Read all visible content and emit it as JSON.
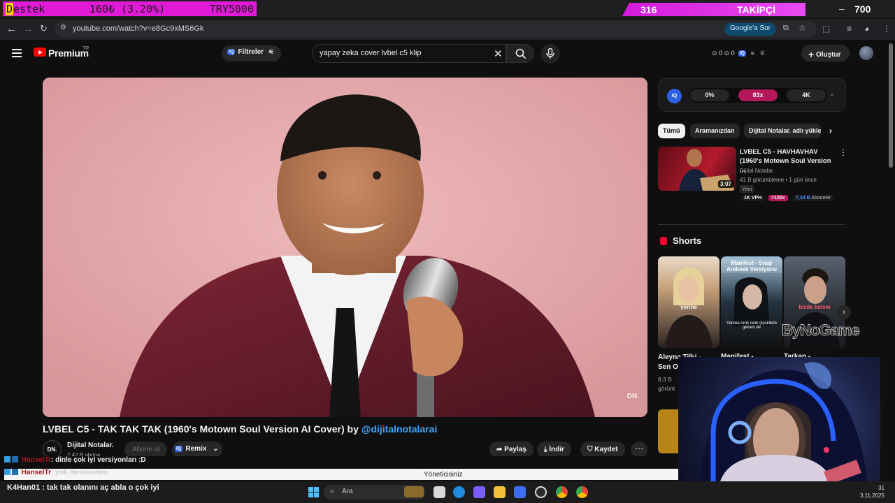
{
  "overlay": {
    "destek_first": "D",
    "destek_rest": "estek",
    "goal_amount": "160₺ (3.20%)",
    "goal_target": "TRY5000",
    "follower_count": "316",
    "follower_label": "TAKİPÇİ",
    "minimize": "–",
    "counter": "700"
  },
  "browser": {
    "url": "youtube.com/watch?v=e8Gc9xMS6Gk",
    "ask_google": "Google'a Sor"
  },
  "header": {
    "brand": "Premium",
    "country": "TR",
    "filters_label": "Filtreler",
    "search_value": "yapay zeka cover lvbel c5 klip",
    "header_stats": "⊙ 0  ⊙ 0",
    "create_label": "Oluştur"
  },
  "video": {
    "title": "LVBEL C5 - TAK TAK TAK (1960's Motown Soul Version AI Cover) by ",
    "title_link": "@dijitalnotalarai",
    "watermark": "DN.",
    "channel_avatar": "DN.",
    "channel_name": "Dijital Notalar.",
    "channel_subs": "7,42 B abone",
    "subscribe_label": "Abone ol",
    "remix_label": "Remix",
    "share_label": "Paylaş",
    "download_label": "İndir",
    "save_label": "Kaydet"
  },
  "iq_panel": {
    "badge": "IQ",
    "pill_1": "0%",
    "pill_2": "83x",
    "pill_3": "4K",
    "colors": {
      "highlight": "#b4185a"
    }
  },
  "chips": [
    "Tümü",
    "Aramanızdan",
    "Dijital Notalar. adlı yükleyiciden"
  ],
  "recommended": {
    "title": "LVBEL C5 - HAVHAVHAV (1960's Motown Soul Version ...",
    "channel": "Dijital Notalar.",
    "meta": "41 B görüntüleme • 1 gün önce",
    "badge_new": "Yeni",
    "duration": "3:07",
    "vph": "1K VPH",
    "outlier": ">100x",
    "subs_value": "7,34 B",
    "subs_label": "Aboneler"
  },
  "shorts": {
    "heading": "Shorts",
    "items": [
      {
        "title_line1": "Aleyna Tilki -",
        "title_line2": "Sen O",
        "meta_line1": "8,3 B",
        "meta_line2": "görünt",
        "caption": "yerine"
      },
      {
        "title_line1": "Manifest -",
        "caption_top": "Manifest - Snap Arabesk Versiyonu",
        "caption_bottom": "Yanına renk renk çiçeklerle gelsen de"
      },
      {
        "title_line1": "Tarkan -",
        "caption": "bizde kalsın"
      }
    ],
    "sponsor": "ByNoGame"
  },
  "chat": {
    "line1_user": "HanselTr",
    "line1_msg": ": dinle çok iyi versiyonları :D",
    "line2_user": "HanselTr",
    "line2_msg": ": yok mealesefen",
    "mod_notice": "Yöneticisiniz",
    "taskbar_line": "K4Han01 : tak tak olanını aç abla o çok iyi"
  },
  "taskbar": {
    "search_placeholder": "Ara",
    "time": "31",
    "date": "3.11.2025"
  }
}
